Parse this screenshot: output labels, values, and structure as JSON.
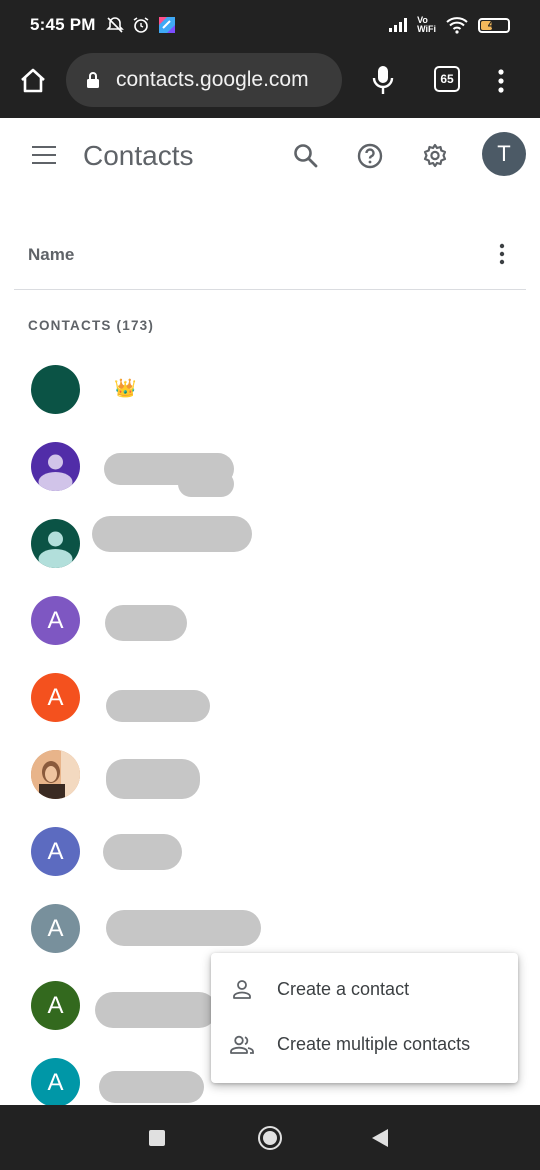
{
  "status_bar": {
    "time": "5:45 PM",
    "wifi_label_top": "Vo",
    "wifi_label_bottom": "WiFi",
    "battery": "40"
  },
  "browser": {
    "url": "contacts.google.com",
    "tab_count": "65",
    "icons": [
      "home-icon",
      "lock-icon",
      "mic-icon",
      "tabs-icon",
      "more-vert-icon"
    ]
  },
  "app": {
    "title": "Contacts",
    "avatar_letter": "T",
    "icons": [
      "menu-icon",
      "search-icon",
      "help-icon",
      "settings-icon"
    ]
  },
  "list_header": {
    "name_label": "Name",
    "section_label": "CONTACTS (173)"
  },
  "contacts": [
    {
      "avatar": "",
      "avatar_color": "#0b5345",
      "name": "👑"
    },
    {
      "avatar": "person-icon",
      "avatar_color": "#512da8"
    },
    {
      "avatar": "person-icon",
      "avatar_color": "#0b5345"
    },
    {
      "avatar": "A",
      "avatar_color": "#7e57c2"
    },
    {
      "avatar": "A",
      "avatar_color": "#f4511e"
    },
    {
      "avatar": "photo",
      "avatar_color": "#c98a5c"
    },
    {
      "avatar": "A",
      "avatar_color": "#5c6bc0"
    },
    {
      "avatar": "A",
      "avatar_color": "#78909c"
    },
    {
      "avatar": "A",
      "avatar_color": "#33691e"
    },
    {
      "avatar": "A",
      "avatar_color": "#0097a7"
    }
  ],
  "popup_menu": {
    "items": [
      {
        "label": "Create a contact",
        "icon": "person-outline-icon"
      },
      {
        "label": "Create multiple contacts",
        "icon": "people-outline-icon"
      }
    ]
  },
  "nav": {
    "icons": [
      "recents-square-icon",
      "home-circle-icon",
      "back-triangle-icon"
    ]
  }
}
